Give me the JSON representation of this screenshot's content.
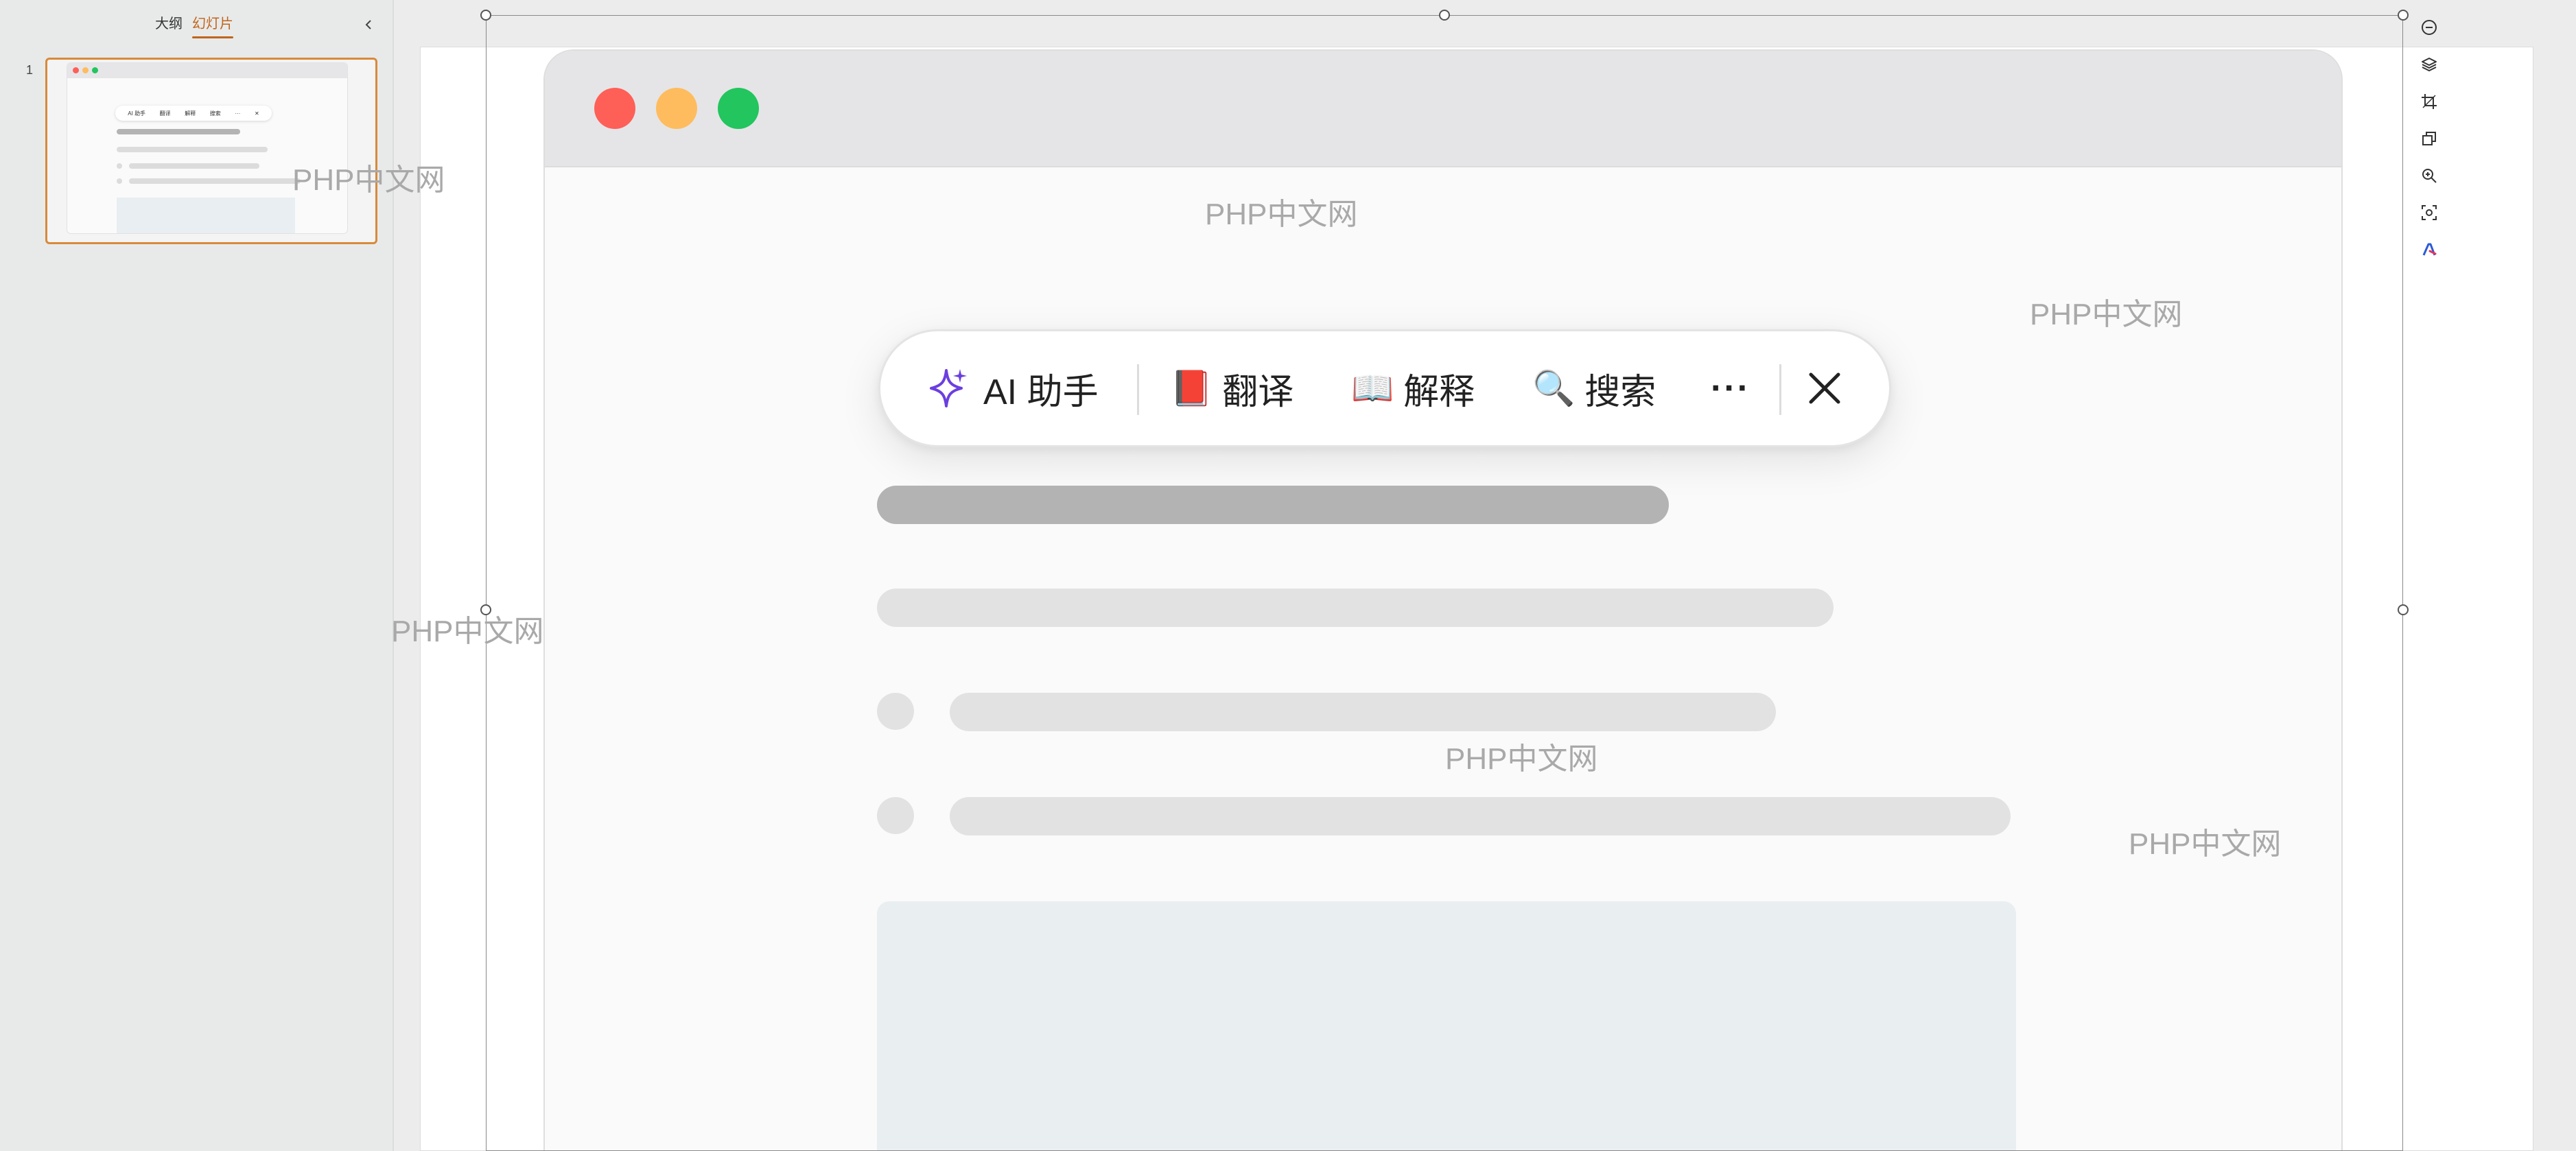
{
  "left_panel": {
    "tabs": [
      {
        "label": "大纲",
        "active": false
      },
      {
        "label": "幻灯片",
        "active": true
      }
    ],
    "collapse_icon": "chevron-left-icon",
    "slide_number": "1",
    "thumbnail": {
      "toolbar_items": [
        "AI 助手",
        "翻译",
        "解释",
        "搜索",
        "···",
        "✕"
      ]
    }
  },
  "slide": {
    "mock_window": {
      "traffic_lights": {
        "red": "#fe5f57",
        "yellow": "#febc5e",
        "green": "#22c55e"
      }
    },
    "ai_toolbar": {
      "items": [
        {
          "icon": "sparkle-icon",
          "label": "AI 助手"
        },
        {
          "icon": "red-book-icon",
          "emoji": "📕",
          "label": "翻译"
        },
        {
          "icon": "open-book-icon",
          "emoji": "📖",
          "label": "解释"
        },
        {
          "icon": "magnifier-icon",
          "emoji": "🔍",
          "label": "搜索"
        }
      ],
      "more_label": "···",
      "close_icon": "close-icon"
    }
  },
  "watermarks": [
    "PHP中文网",
    "PHP中文网",
    "PHP中文网",
    "PHP中文网",
    "PHP中文网",
    "PHP中文网"
  ],
  "right_tools": [
    "minus-circle-icon",
    "layers-icon",
    "crop-icon",
    "duplicate-icon",
    "zoom-in-icon",
    "scan-icon",
    "ai-logo-icon"
  ],
  "colors": {
    "accent": "#c0641a",
    "thumb_border": "#d88a3a",
    "sparkle": "#6b3fe0"
  }
}
